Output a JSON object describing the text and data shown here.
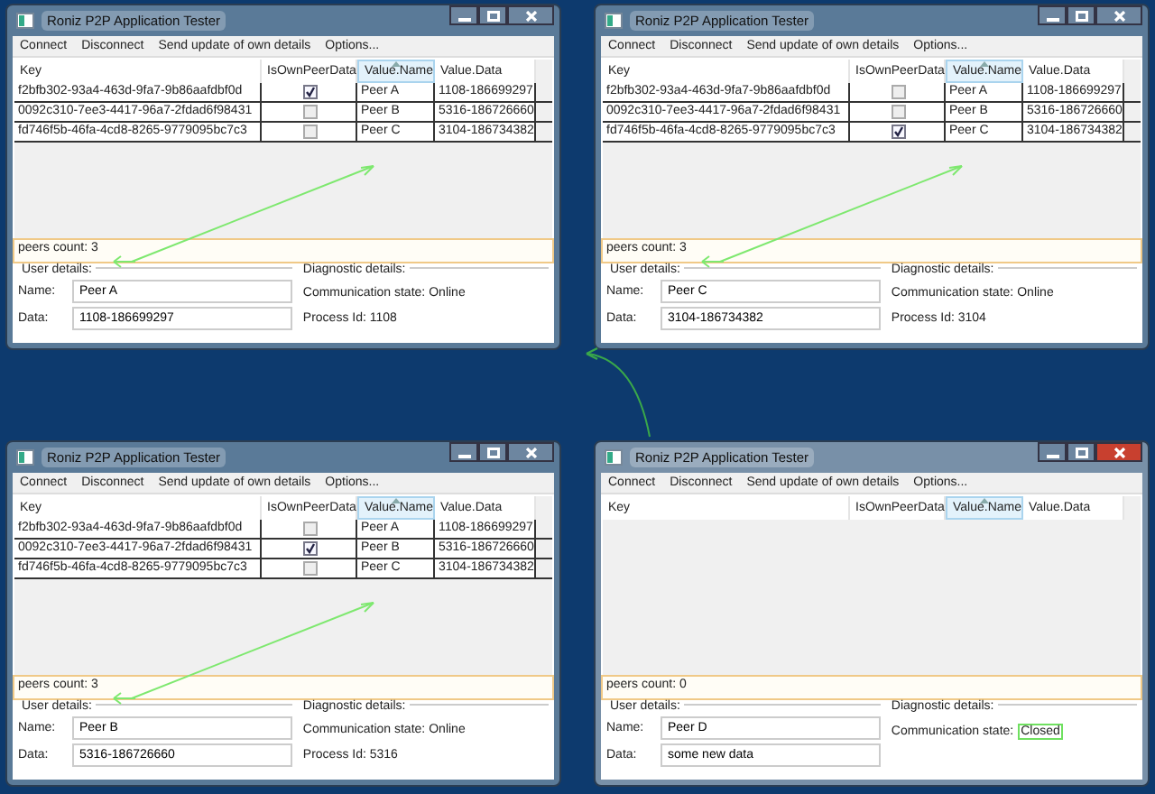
{
  "windows": [
    {
      "title": "Roniz P2P Application Tester",
      "active": false,
      "menu": [
        "Connect",
        "Disconnect",
        "Send update of own details",
        "Options..."
      ],
      "columns": [
        {
          "label": "Key",
          "sorted": false
        },
        {
          "label": "IsOwnPeerData",
          "sorted": false
        },
        {
          "label": "Value.Name",
          "sorted": true
        },
        {
          "label": "Value.Data",
          "sorted": false
        }
      ],
      "rows": [
        {
          "key": "f2bfb302-93a4-463d-9fa7-9b86aafdbf0d",
          "is_own": true,
          "name": "Peer A",
          "data": "1108-186699297"
        },
        {
          "key": "0092c310-7ee3-4417-96a7-2fdad6f98431",
          "is_own": false,
          "name": "Peer B",
          "data": "5316-186726660"
        },
        {
          "key": "fd746f5b-46fa-4cd8-8265-9779095bc7c3",
          "is_own": false,
          "name": "Peer C",
          "data": "3104-186734382"
        }
      ],
      "status": "peers count: 3",
      "user_details": {
        "title": "User details:",
        "name_label": "Name:",
        "name_value": "Peer A",
        "data_label": "Data:",
        "data_value": "1108-186699297"
      },
      "diagnostic": {
        "title": "Diagnostic details:",
        "state_label": "Communication state:",
        "state_value": "Online",
        "highlighted": false,
        "process": "Process Id: 1108"
      }
    },
    {
      "title": "Roniz P2P Application Tester",
      "active": false,
      "menu": [
        "Connect",
        "Disconnect",
        "Send update of own details",
        "Options..."
      ],
      "columns": [
        {
          "label": "Key",
          "sorted": false
        },
        {
          "label": "IsOwnPeerData",
          "sorted": false
        },
        {
          "label": "Value.Name",
          "sorted": true
        },
        {
          "label": "Value.Data",
          "sorted": false
        }
      ],
      "rows": [
        {
          "key": "f2bfb302-93a4-463d-9fa7-9b86aafdbf0d",
          "is_own": false,
          "name": "Peer A",
          "data": "1108-186699297"
        },
        {
          "key": "0092c310-7ee3-4417-96a7-2fdad6f98431",
          "is_own": false,
          "name": "Peer B",
          "data": "5316-186726660"
        },
        {
          "key": "fd746f5b-46fa-4cd8-8265-9779095bc7c3",
          "is_own": true,
          "name": "Peer C",
          "data": "3104-186734382"
        }
      ],
      "status": "peers count: 3",
      "user_details": {
        "title": "User details:",
        "name_label": "Name:",
        "name_value": "Peer C",
        "data_label": "Data:",
        "data_value": "3104-186734382"
      },
      "diagnostic": {
        "title": "Diagnostic details:",
        "state_label": "Communication state:",
        "state_value": "Online",
        "highlighted": false,
        "process": "Process Id: 3104"
      }
    },
    {
      "title": "Roniz P2P Application Tester",
      "active": false,
      "menu": [
        "Connect",
        "Disconnect",
        "Send update of own details",
        "Options..."
      ],
      "columns": [
        {
          "label": "Key",
          "sorted": false
        },
        {
          "label": "IsOwnPeerData",
          "sorted": false
        },
        {
          "label": "Value.Name",
          "sorted": true
        },
        {
          "label": "Value.Data",
          "sorted": false
        }
      ],
      "rows": [
        {
          "key": "f2bfb302-93a4-463d-9fa7-9b86aafdbf0d",
          "is_own": false,
          "name": "Peer A",
          "data": "1108-186699297"
        },
        {
          "key": "0092c310-7ee3-4417-96a7-2fdad6f98431",
          "is_own": true,
          "name": "Peer B",
          "data": "5316-186726660"
        },
        {
          "key": "fd746f5b-46fa-4cd8-8265-9779095bc7c3",
          "is_own": false,
          "name": "Peer C",
          "data": "3104-186734382"
        }
      ],
      "status": "peers count: 3",
      "user_details": {
        "title": "User details:",
        "name_label": "Name:",
        "name_value": "Peer B",
        "data_label": "Data:",
        "data_value": "5316-186726660"
      },
      "diagnostic": {
        "title": "Diagnostic details:",
        "state_label": "Communication state:",
        "state_value": "Online",
        "highlighted": false,
        "process": "Process Id: 5316"
      }
    },
    {
      "title": "Roniz P2P Application Tester",
      "active": true,
      "menu": [
        "Connect",
        "Disconnect",
        "Send update of own details",
        "Options..."
      ],
      "columns": [
        {
          "label": "Key",
          "sorted": false
        },
        {
          "label": "IsOwnPeerData",
          "sorted": false
        },
        {
          "label": "Value.Name",
          "sorted": true
        },
        {
          "label": "Value.Data",
          "sorted": false
        }
      ],
      "status": "peers count: 0",
      "user_details": {
        "title": "User details:",
        "name_label": "Name:",
        "name_value": "Peer D",
        "data_label": "Data:",
        "data_value": "some new data"
      },
      "diagnostic": {
        "title": "Diagnostic details:",
        "state_label": "Communication state:",
        "state_value": "Closed",
        "highlighted": true
      }
    }
  ]
}
